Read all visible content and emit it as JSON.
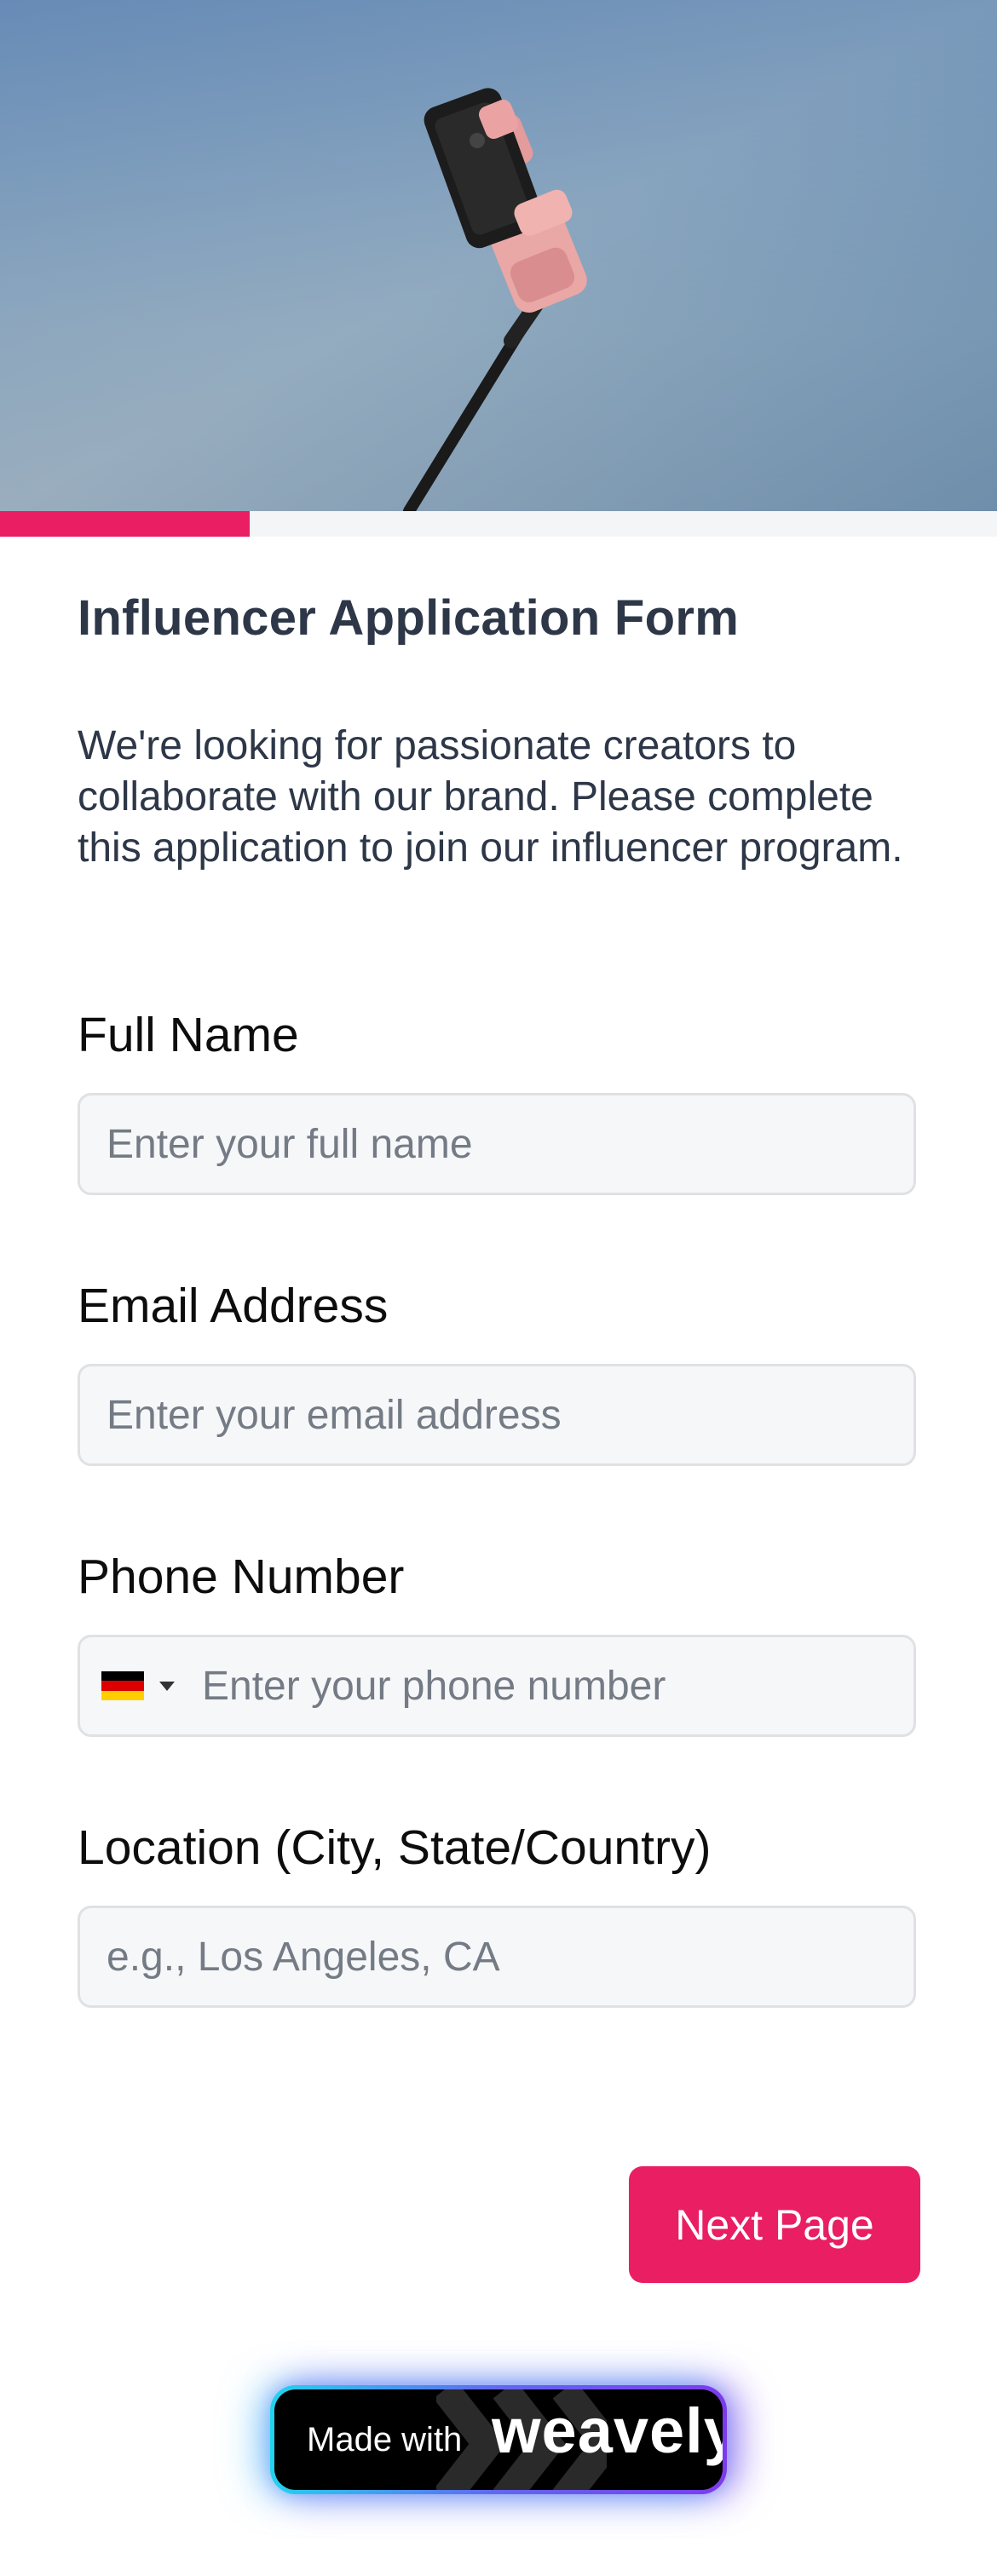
{
  "progress": {
    "fraction": 0.25
  },
  "form": {
    "title": "Influencer Application Form",
    "description": "We're looking for passionate creators to collaborate with our brand. Please complete this application to join our influencer program.",
    "fields": [
      {
        "label": "Full Name",
        "placeholder": "Enter your full name"
      },
      {
        "label": "Email Address",
        "placeholder": "Enter your email address"
      },
      {
        "label": "Phone Number",
        "placeholder": "Enter your phone number",
        "country_flag": "germany-flag-icon"
      },
      {
        "label": "Location (City, State/Country)",
        "placeholder": "e.g., Los Angeles, CA"
      }
    ],
    "next_button": "Next Page"
  },
  "footer": {
    "made_with": "Made with",
    "brand": "weavely"
  },
  "colors": {
    "accent": "#e91e63",
    "title": "#2d3748",
    "input_bg": "#f6f7f9"
  }
}
